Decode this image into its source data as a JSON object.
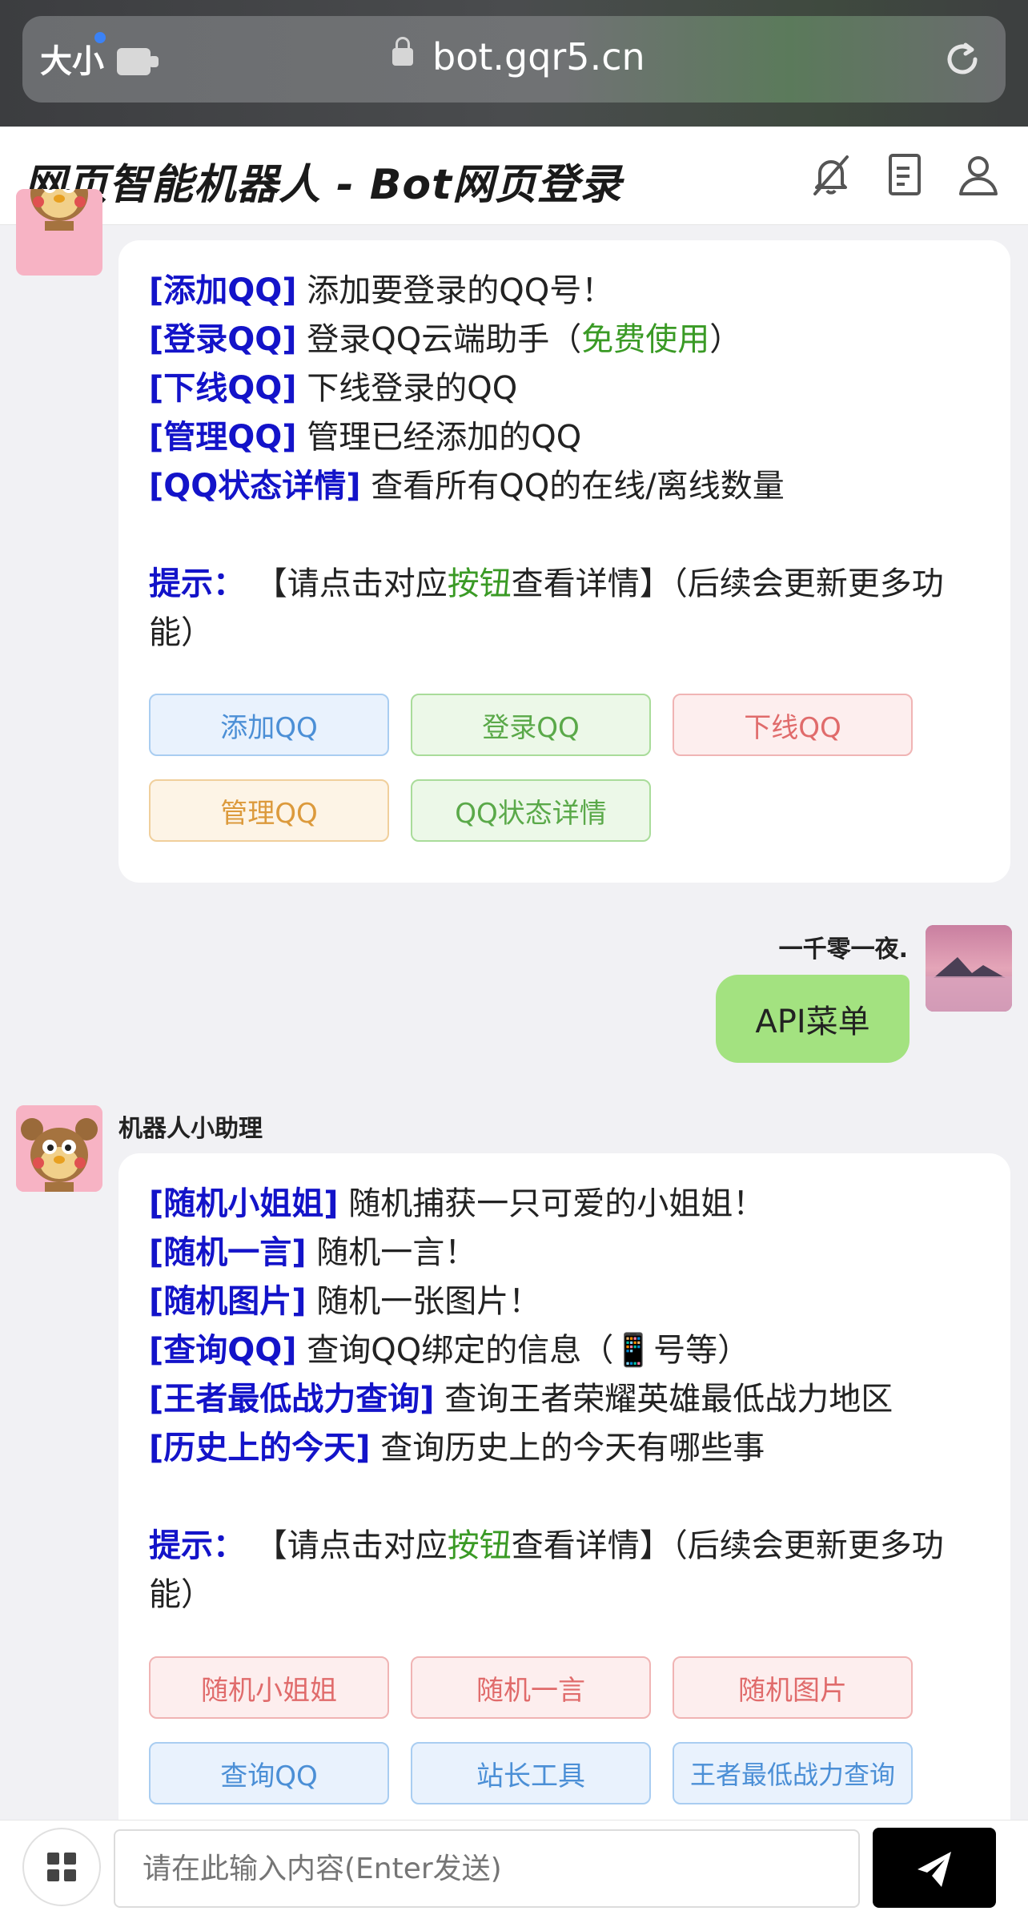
{
  "browser": {
    "size_label": "大小",
    "url": "bot.gqr5.cn"
  },
  "header": {
    "title": "网页智能机器人 - Bot网页登录"
  },
  "bubble1": {
    "lines": [
      {
        "cmd": "[添加QQ]",
        "text": " 添加要登录的QQ号！"
      },
      {
        "cmd": "[登录QQ]",
        "text": " 登录QQ云端助手（",
        "green": "免费使用",
        "tail": "）"
      },
      {
        "cmd": "[下线QQ]",
        "text": " 下线登录的QQ"
      },
      {
        "cmd": "[管理QQ]",
        "text": " 管理已经添加的QQ"
      },
      {
        "cmd": "[QQ状态详情]",
        "text": " 查看所有QQ的在线/离线数量"
      }
    ],
    "tip": {
      "label": "提示：",
      "pre": " 【请点击对应",
      "green": "按钮",
      "post": "查看详情】（后续会更新更多功",
      "line2": "能）"
    },
    "buttons": [
      "添加QQ",
      "登录QQ",
      "下线QQ",
      "管理QQ",
      "QQ状态详情"
    ]
  },
  "user_msg": {
    "name": "一千零一夜.",
    "text": "API菜单"
  },
  "bubble2": {
    "bot_name": "机器人小助理",
    "lines": [
      {
        "cmd": "[随机小姐姐]",
        "text": " 随机捕获一只可爱的小姐姐！"
      },
      {
        "cmd": "[随机一言]",
        "text": " 随机一言！"
      },
      {
        "cmd": "[随机图片]",
        "text": " 随机一张图片！"
      },
      {
        "cmd": "[查询QQ]",
        "text": " 查询QQ绑定的信息（📱号等）"
      },
      {
        "cmd": "[王者最低战力查询]",
        "text": " 查询王者荣耀英雄最低战力地区"
      },
      {
        "cmd": "[历史上的今天]",
        "text": " 查询历史上的今天有哪些事"
      }
    ],
    "tip": {
      "label": "提示：",
      "pre": " 【请点击对应",
      "green": "按钮",
      "post": "查看详情】（后续会更新更多功",
      "line2": "能）"
    },
    "buttons": [
      "随机小姐姐",
      "随机一言",
      "随机图片",
      "查询QQ",
      "站长工具",
      "王者最低战力查询"
    ]
  },
  "input": {
    "placeholder": "请在此输入内容(Enter发送)"
  },
  "icons": {
    "header": [
      "bell-off-icon",
      "document-icon",
      "user-icon"
    ],
    "send": "send-icon",
    "menu": "grid-icon"
  }
}
